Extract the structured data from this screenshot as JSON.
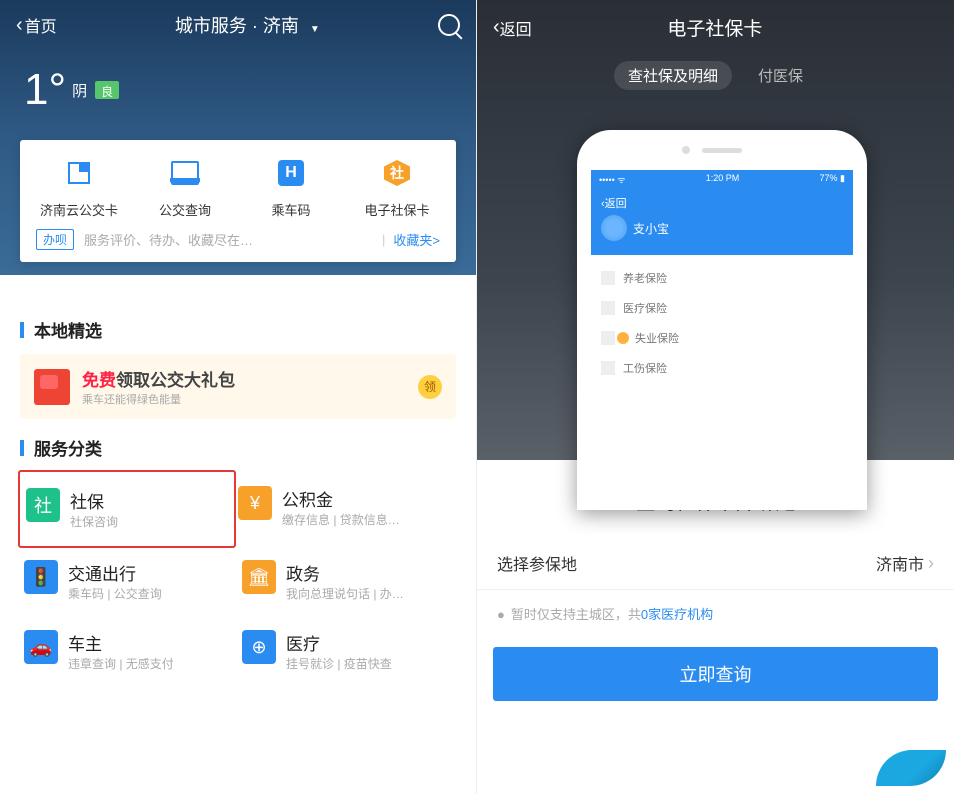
{
  "left": {
    "nav": {
      "home": "首页",
      "title": "城市服务 · 济南"
    },
    "weather": {
      "temp": "1°",
      "cond": "阴",
      "aqi": "良"
    },
    "quick": {
      "items": [
        {
          "name": "济南云公交卡"
        },
        {
          "name": "公交查询"
        },
        {
          "name": "乘车码"
        },
        {
          "name": "电子社保卡"
        }
      ],
      "banli_tag": "办呗",
      "banli_text": "服务评价、待办、收藏尽在…",
      "favorites": "收藏夹>"
    },
    "sections": {
      "local": "本地精选",
      "services": "服务分类"
    },
    "promo": {
      "red": "免费",
      "rest": "领取公交大礼包",
      "sub": "乘车还能得绿色能量",
      "btn": "领"
    },
    "services": [
      {
        "title": "社保",
        "sub": "社保咨询",
        "icon": "社",
        "cls": "i-shebao",
        "hl": true
      },
      {
        "title": "公积金",
        "sub": "缴存信息 | 贷款信息…",
        "icon": "¥",
        "cls": "i-gjj"
      },
      {
        "title": "交通出行",
        "sub": "乘车码 | 公交查询",
        "icon": "🚦",
        "cls": "i-traffic"
      },
      {
        "title": "政务",
        "sub": "我向总理说句话 | 办…",
        "icon": "🏛",
        "cls": "i-gov"
      },
      {
        "title": "车主",
        "sub": "违章查询 | 无感支付",
        "icon": "🚗",
        "cls": "i-car"
      },
      {
        "title": "医疗",
        "sub": "挂号就诊 | 疫苗快查",
        "icon": "⊕",
        "cls": "i-med"
      }
    ]
  },
  "right": {
    "back": "返回",
    "title": "电子社保卡",
    "tabs": [
      "查社保及明细",
      "付医保"
    ],
    "phone": {
      "status": {
        "time": "1:20 PM",
        "batt": "77%"
      },
      "back": "返回",
      "user": "支小宝",
      "items": [
        "养老保险",
        "医疗保险",
        "失业保险",
        "工伤保险"
      ]
    },
    "section_title": "查询社保卡并绑定",
    "row": {
      "label": "选择参保地",
      "val": "济南市"
    },
    "hint_pre": "暂时仅支持主城区，共",
    "hint_num": "0家医疗机构",
    "cta": "立即查询"
  }
}
